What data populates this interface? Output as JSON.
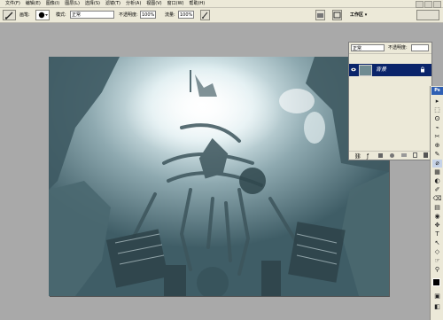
{
  "menu": [
    "文件(F)",
    "编辑(E)",
    "图像(I)",
    "图层(L)",
    "选择(S)",
    "滤镜(T)",
    "分析(A)",
    "视图(V)",
    "窗口(W)",
    "帮助(H)"
  ],
  "options": {
    "brush_label": "画笔:",
    "brush_size": "",
    "mode_label": "模式:",
    "mode_value": "正常",
    "opacity_label": "不透明度:",
    "opacity_value": "100%",
    "flow_label": "流量:",
    "flow_value": "100%",
    "workspace_label": "工作区 ▾"
  },
  "layers_panel": {
    "blend_mode": "正常",
    "opacity_label": "不透明度:",
    "opacity_value": "",
    "layer_name": "背景"
  },
  "toolbox": {
    "badge": "Ps",
    "tools": [
      "▸",
      "⬚",
      "ʘ",
      "⌁",
      "✂",
      "⊕",
      "✎",
      "⌀",
      "▦",
      "◐",
      "✐",
      "⌫",
      "▤",
      "◉",
      "✥",
      "T",
      "↖",
      "◇",
      "☞",
      "⚲",
      "▣",
      "◧"
    ]
  },
  "colors": {
    "chrome": "#ece9d8",
    "workspace": "#a9a9a9",
    "canvas_base": "#5e7a82",
    "selected_layer": "#0a246a",
    "badge": "#2f5fb3"
  }
}
